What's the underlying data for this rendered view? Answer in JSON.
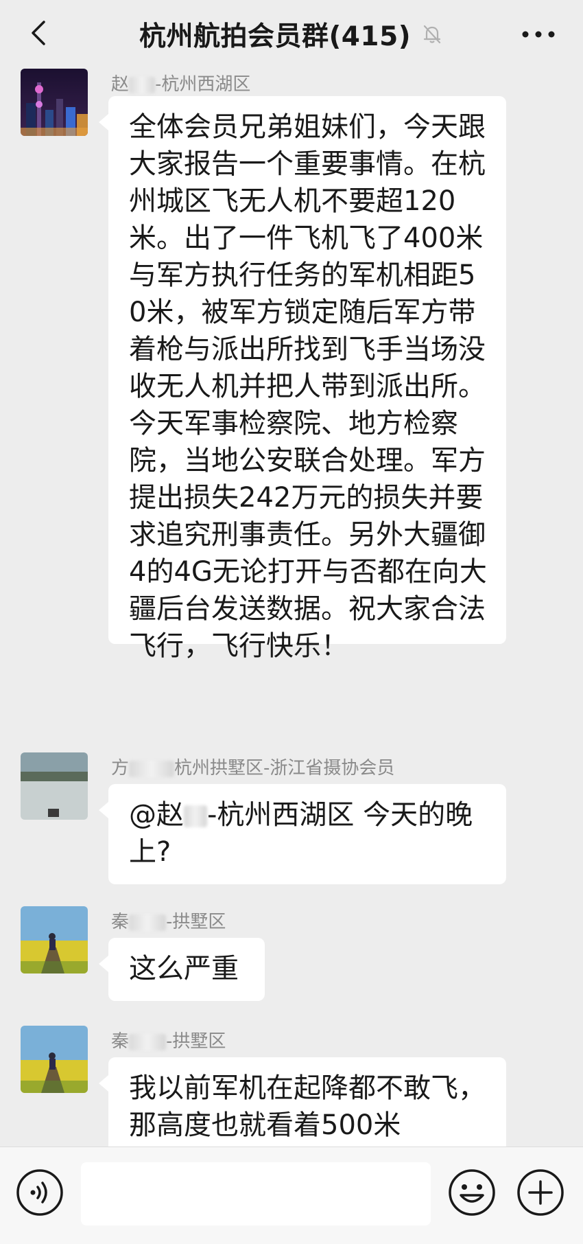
{
  "header": {
    "title": "杭州航拍会员群(415)",
    "back_icon": "chevron-left-icon",
    "mute_icon": "bell-off-icon",
    "more_icon": "more-dots-icon"
  },
  "messages": [
    {
      "sender_prefix": "赵",
      "sender_suffix": "-杭州西湖区",
      "avatar_icon": "city-night-avatar",
      "text": "全体会员兄弟姐妹们，今天跟大家报告一个重要事情。在杭州城区飞无人机不要超120米。出了一件飞机飞了400米与军方执行任务的军机相距50米，被军方锁定随后军方带着枪与派出所找到飞手当场没收无人机并把人带到派出所。今天军事检察院、地方检察院，当地公安联合处理。军方提出损失242万元的损失并要求追究刑事责任。另外大疆御4的4G无论打开与否都在向大疆后台发送数据。祝大家合法飞行，飞行快乐！"
    },
    {
      "sender_prefix": "方",
      "sender_suffix": "杭州拱墅区-浙江省摄协会员",
      "avatar_icon": "lake-avatar",
      "text_prefix": "@赵",
      "text_suffix": "-杭州西湖区  今天的晚上?"
    },
    {
      "sender_prefix": "秦",
      "sender_suffix": "-拱墅区",
      "avatar_icon": "field-person-avatar",
      "text": "这么严重"
    },
    {
      "sender_prefix": "秦",
      "sender_suffix": "-拱墅区",
      "avatar_icon": "field-person-avatar",
      "text": "我以前军机在起降都不敢飞，那高度也就看着500米"
    }
  ],
  "input_bar": {
    "voice_icon": "voice-icon",
    "emoji_icon": "emoji-icon",
    "plus_icon": "plus-circle-icon",
    "input_value": ""
  },
  "colors": {
    "background": "#ededed",
    "bubble": "#ffffff",
    "sender": "#8a8a8a"
  }
}
